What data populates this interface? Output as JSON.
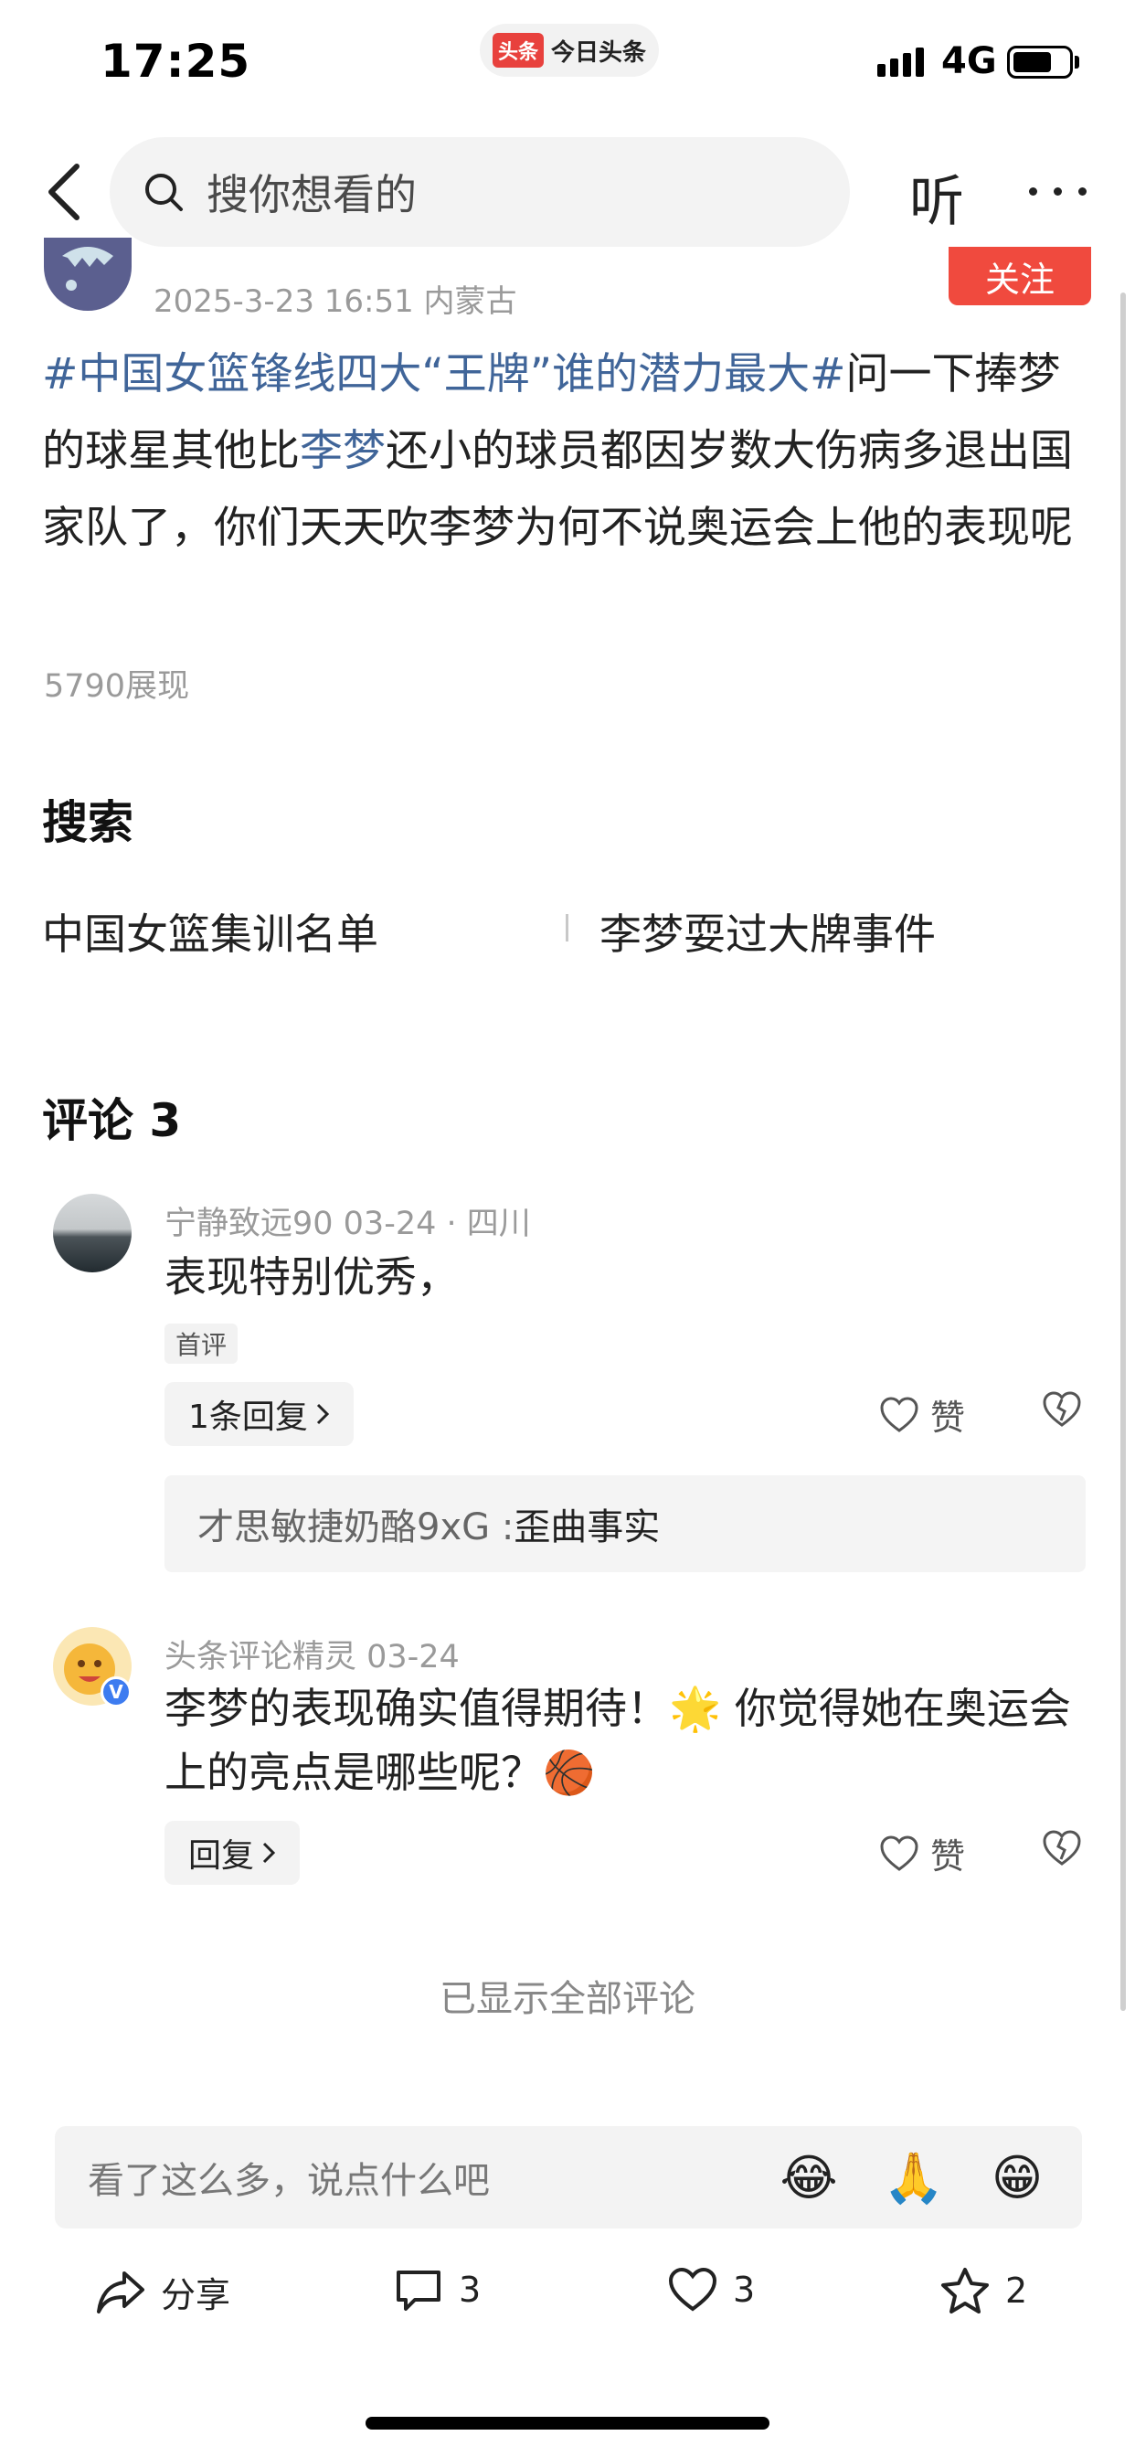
{
  "status_bar": {
    "time": "17:25",
    "app_logo": "头条",
    "app_name": "今日头条",
    "network": "4G",
    "battery_level": 0.7
  },
  "nav": {
    "search_placeholder": "搜你想看的",
    "listen_label": "听"
  },
  "author": {
    "meta": "2025-3-23 16:51  内蒙古",
    "follow_label": "关注"
  },
  "post": {
    "hashtag": "#中国女篮锋线四大“王牌”谁的潜力最大#",
    "text_1": "问一下捧梦的球星其他比",
    "keyword": "李梦",
    "text_2": "还小的球员都因岁数大伤病多退出国家队了，你们天天吹李梦为何不说奥运会上他的表现呢",
    "views": "5790展现"
  },
  "search": {
    "heading": "搜索",
    "suggestions": [
      "中国女篮集训名单",
      "李梦耍过大牌事件"
    ]
  },
  "comments": {
    "heading": "评论 3",
    "items": [
      {
        "meta": "宁静致远90   03-24 · 四川",
        "text": "表现特别优秀，",
        "badge": "首评",
        "reply_label": "1条回复",
        "like_label": "赞",
        "sub_reply_name": "才思敏捷奶酪9xG : ",
        "sub_reply_text": "歪曲事实"
      },
      {
        "meta": "头条评论精灵   03-24",
        "text": "李梦的表现确实值得期待！🌟 你觉得她在奥运会上的亮点是哪些呢？🏀",
        "reply_label": "回复",
        "like_label": "赞",
        "verified": "V"
      }
    ],
    "all_shown": "已显示全部评论"
  },
  "composer": {
    "placeholder": "看了这么多，说点什么吧",
    "emojis": [
      "😂",
      "🙏",
      "😁"
    ]
  },
  "bottom_bar": {
    "share_label": "分享",
    "comment_count": "3",
    "like_count": "3",
    "favorite_count": "2"
  }
}
